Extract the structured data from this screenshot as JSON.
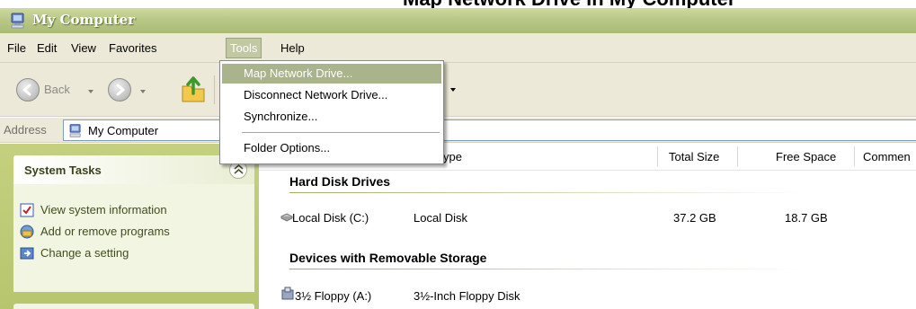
{
  "caption": {
    "text": "Map Network Drive in My Computer"
  },
  "window": {
    "title": "My Computer"
  },
  "menubar": {
    "items": [
      "File",
      "Edit",
      "View",
      "Favorites",
      "Tools",
      "Help"
    ]
  },
  "toolbar": {
    "back_label": "Back"
  },
  "address": {
    "label": "Address",
    "value": "My Computer"
  },
  "tools_menu": {
    "items": [
      "Map Network Drive...",
      "Disconnect Network Drive...",
      "Synchronize...",
      "Folder Options..."
    ],
    "highlighted": "Map Network Drive..."
  },
  "system_tasks": {
    "title": "System Tasks",
    "items": [
      "View system information",
      "Add or remove programs",
      "Change a setting"
    ]
  },
  "columns": {
    "type": "ype",
    "total_size": "Total Size",
    "free_space": "Free Space",
    "comments": "Commen"
  },
  "groups": {
    "hard_disk": {
      "title": "Hard Disk Drives",
      "rows": [
        {
          "name": "Local Disk (C:)",
          "type": "Local Disk",
          "total_size": "37.2 GB",
          "free_space": "18.7 GB"
        }
      ]
    },
    "removable": {
      "title": "Devices with Removable Storage",
      "rows": [
        {
          "name": "3½ Floppy (A:)",
          "type": "3½-Inch Floppy Disk"
        }
      ]
    }
  },
  "colors": {
    "title_bar": "#b9c887",
    "menu_highlight": "#a9b48c",
    "task_pane": "#c4d07f"
  }
}
